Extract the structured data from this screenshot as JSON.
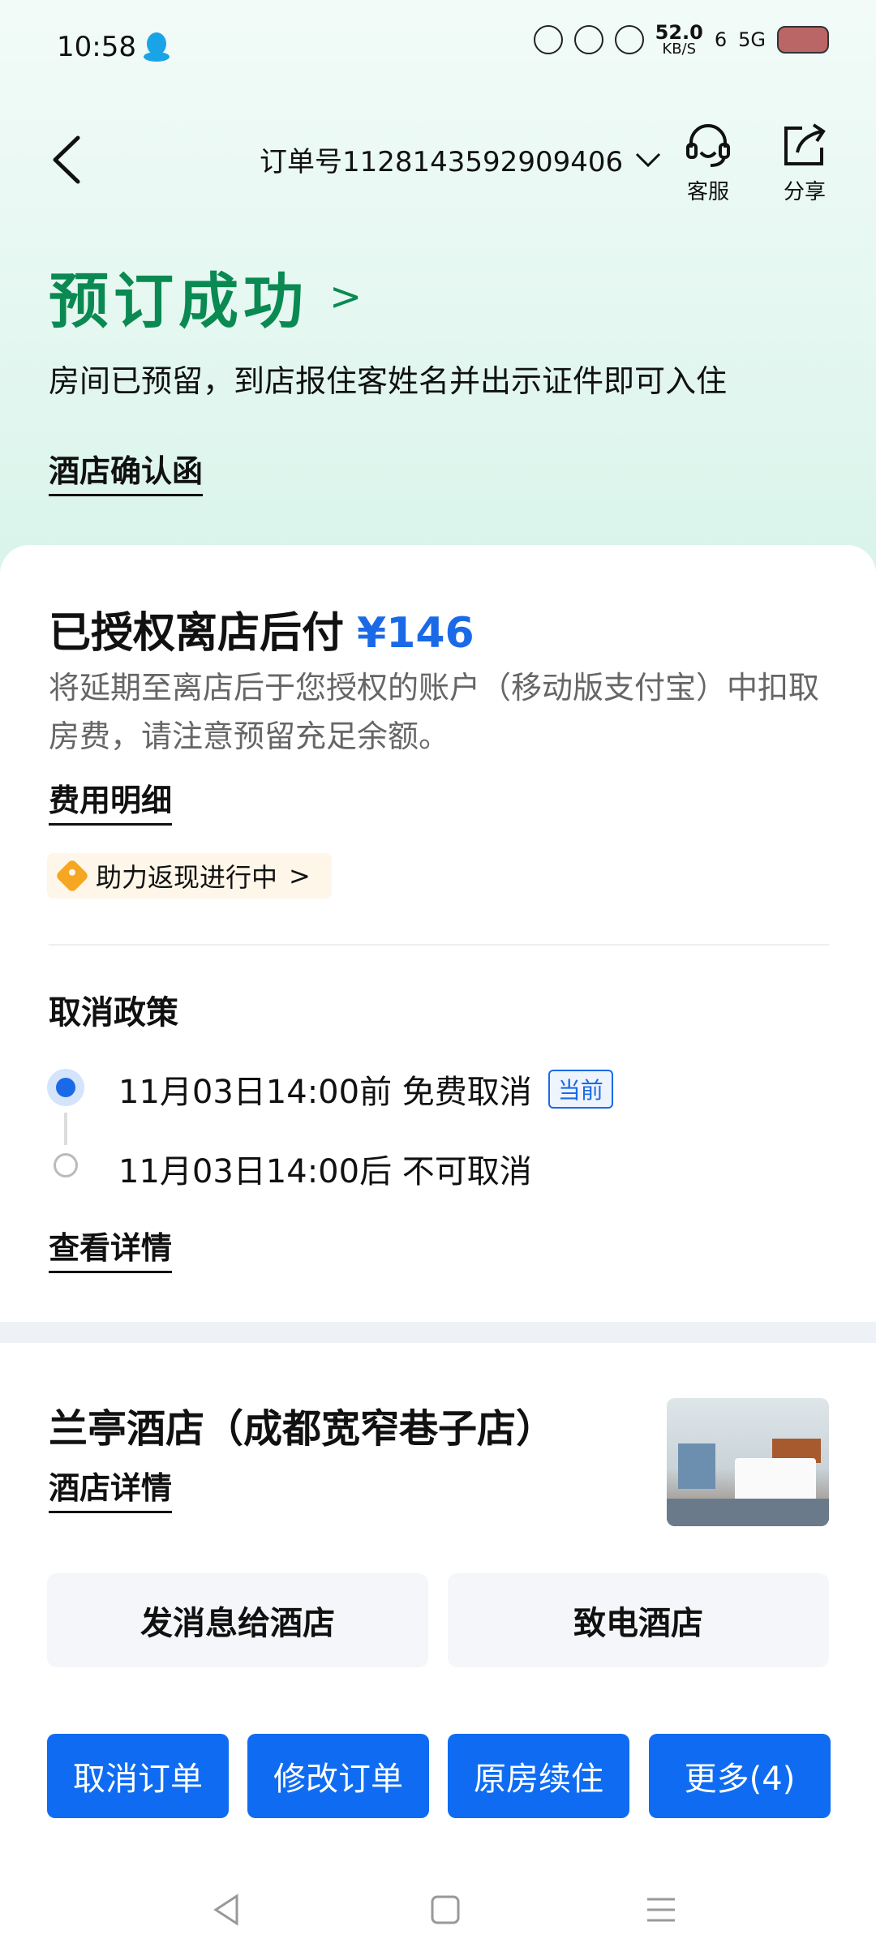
{
  "status_bar": {
    "time": "10:58",
    "speed_value": "52.0",
    "speed_unit": "KB/S",
    "signal_label": "5G",
    "signal_sub": "6"
  },
  "nav": {
    "order_label": "订单号1128143592909406",
    "service_label": "客服",
    "share_label": "分享"
  },
  "header": {
    "title": "预订成功",
    "description": "房间已预留，到店报住客姓名并出示证件即可入住",
    "confirm_link": "酒店确认函"
  },
  "payment": {
    "title": "已授权离店后付",
    "amount": "¥146",
    "description": "将延期至离店后于您授权的账户（移动版支付宝）中扣取房费，请注意预留充足余额。",
    "detail_link": "费用明细",
    "cashback_label": "助力返现进行中"
  },
  "cancel_policy": {
    "title": "取消政策",
    "items": [
      {
        "text": "11月03日14:00前 免费取消",
        "badge": "当前"
      },
      {
        "text": "11月03日14:00后 不可取消",
        "badge": ""
      }
    ],
    "detail_link": "查看详情"
  },
  "hotel": {
    "name": "兰亭酒店（成都宽窄巷子店）",
    "detail_link": "酒店详情",
    "message_button": "发消息给酒店",
    "call_button": "致电酒店"
  },
  "actions": [
    {
      "label": "取消订单"
    },
    {
      "label": "修改订单"
    },
    {
      "label": "原房续住"
    },
    {
      "label": "更多(4)"
    }
  ],
  "colors": {
    "success_green": "#0a8a52",
    "accent_blue": "#0f6cf2",
    "amount_blue": "#1a6ae8"
  }
}
